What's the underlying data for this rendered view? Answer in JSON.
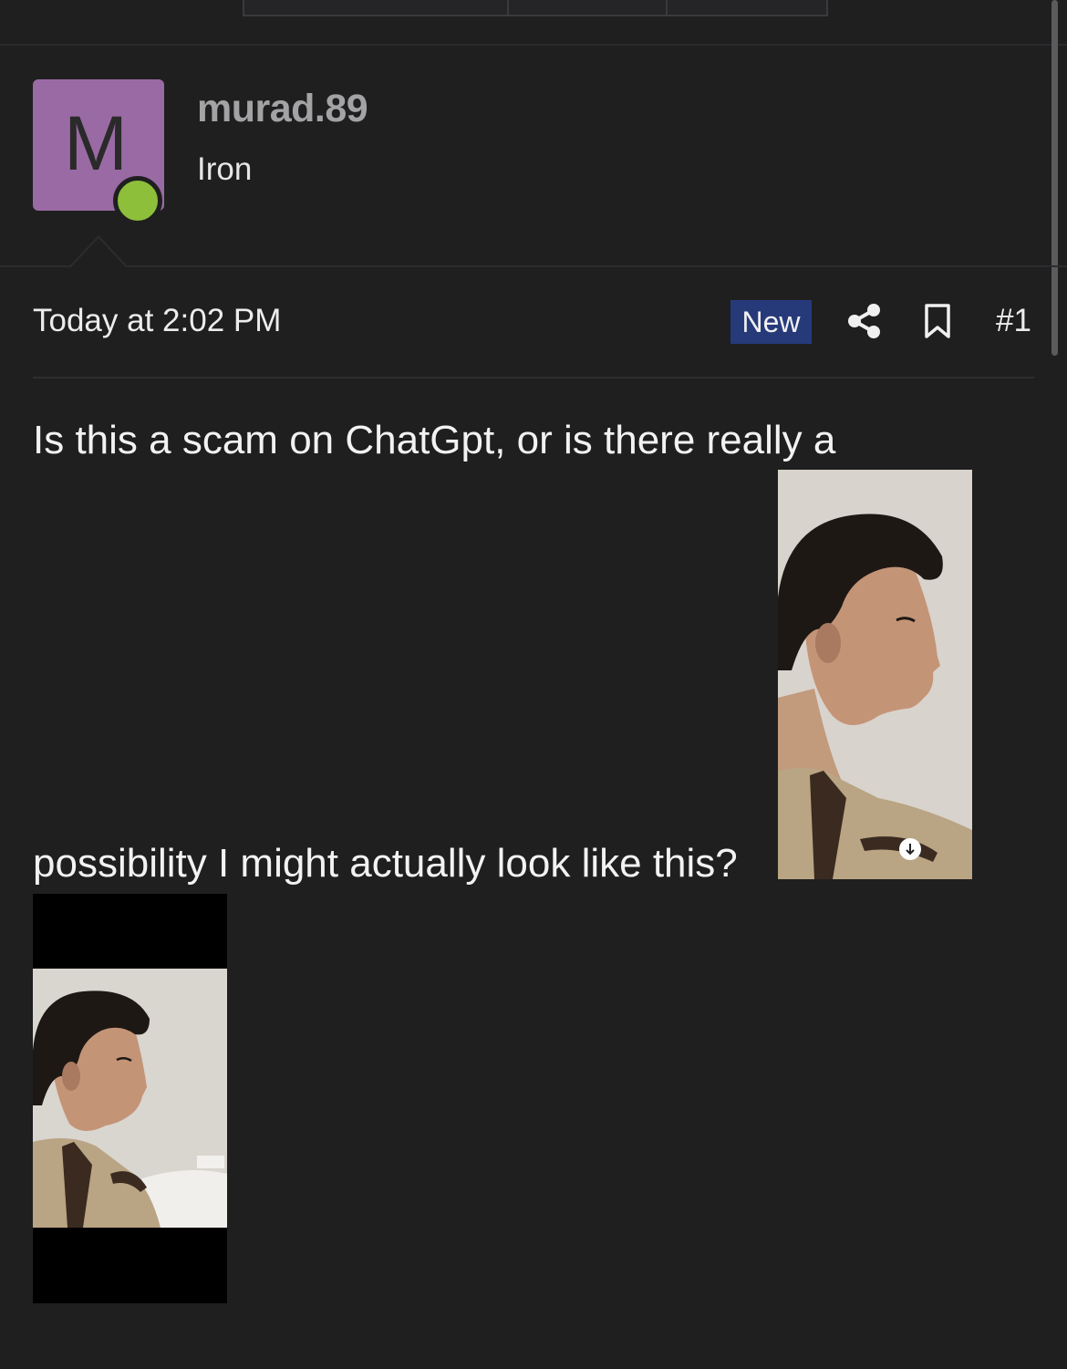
{
  "user": {
    "avatar_letter": "M",
    "username": "murad.89",
    "title": "Iron",
    "online": true
  },
  "post": {
    "timestamp": "Today at 2:02 PM",
    "badge": "New",
    "number": "#1",
    "text_line1": "Is this a scam on ChatGpt, or is there really a",
    "text_line2": "possibility I might actually look like this?"
  },
  "icons": {
    "share": "share-icon",
    "bookmark": "bookmark-icon",
    "download": "download-icon"
  },
  "colors": {
    "background": "#1f1f20",
    "avatar": "#9a6aa4",
    "online": "#8dbf3b",
    "badge": "#263a7a"
  }
}
